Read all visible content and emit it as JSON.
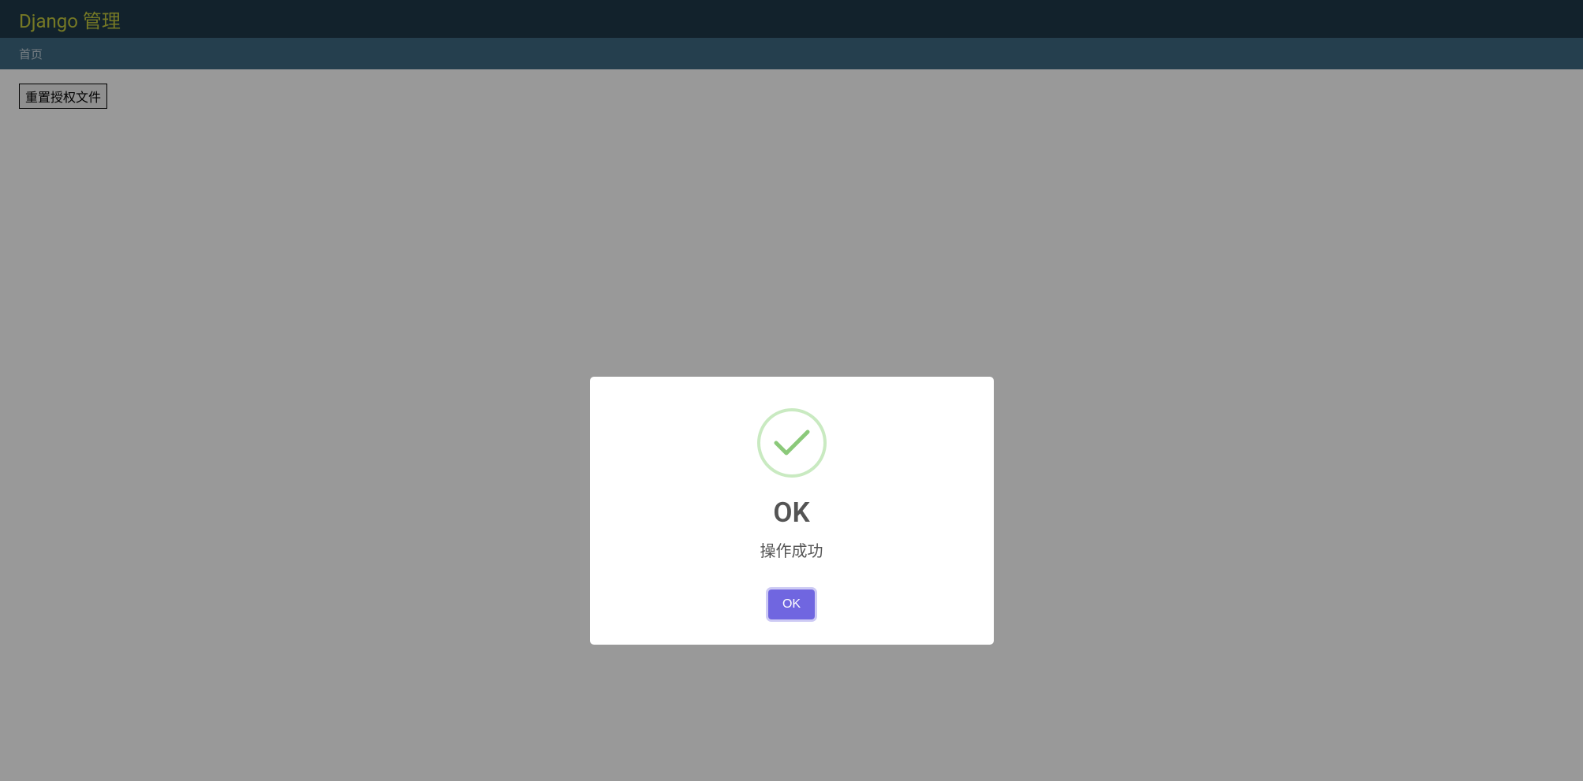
{
  "header": {
    "site_title": "Django 管理"
  },
  "breadcrumb": {
    "home": "首页"
  },
  "content": {
    "reset_button_label": "重置授权文件"
  },
  "modal": {
    "title": "OK",
    "message": "操作成功",
    "ok_button_label": "OK"
  }
}
